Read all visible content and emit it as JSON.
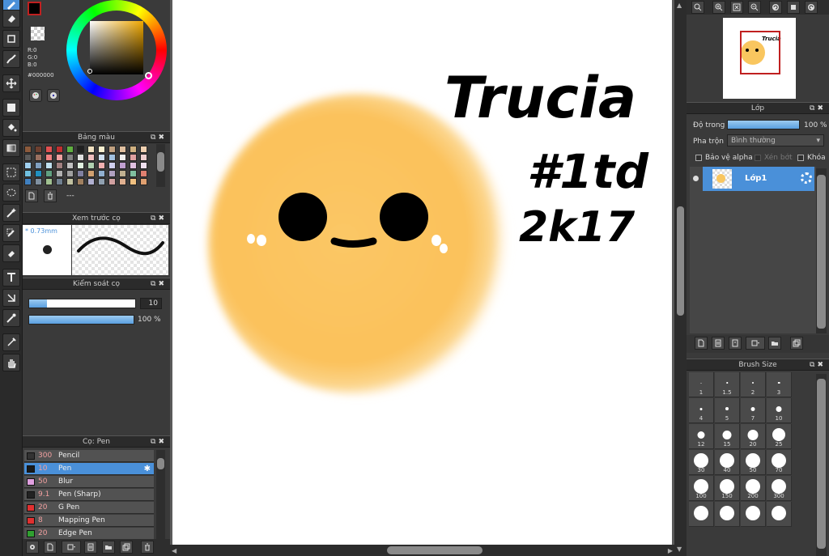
{
  "color": {
    "r_label": "R:0",
    "g_label": "G:0",
    "b_label": "B:0",
    "hex": "#000000",
    "foreground": "#000000",
    "background": "#7a3a2a"
  },
  "palette_panel": {
    "title": "Bảng màu",
    "footer_text": "---",
    "swatches": [
      "#8c5a3c",
      "#6e4030",
      "#e05050",
      "#c03030",
      "#60b040",
      "#202020",
      "#f0e0c0",
      "#f8f0d0",
      "#c0a080",
      "#e0c0a0",
      "#d0b080",
      "#f0d0b0",
      "#5a5a5a",
      "#9a7060",
      "#f08080",
      "#f0a0a0",
      "#808080",
      "#e0e0e0",
      "#f0c0c0",
      "#d0e0f0",
      "#a0c0e0",
      "#f0f0f0",
      "#e0a0a0",
      "#f0d0d0",
      "#a0d0f0",
      "#80a0c0",
      "#c0e0f0",
      "#a08080",
      "#c0c0c0",
      "#e0f0e0",
      "#b0d0b0",
      "#f0b0b0",
      "#d0d0f0",
      "#c0a0d0",
      "#e0c0e0",
      "#f0e0f0",
      "#70c0e0",
      "#2090c0",
      "#60a080",
      "#b0b0b0",
      "#a0a0a0",
      "#8080a0",
      "#d0a070",
      "#90b0d0",
      "#b0a0c0",
      "#c0b090",
      "#80c0a0",
      "#e08070",
      "#4080c0",
      "#8090a0",
      "#a0c090",
      "#708090",
      "#c0c0a0",
      "#a08060",
      "#b0b0d0",
      "#90a0b0",
      "#d0a0a0",
      "#e0b090",
      "#f0c080",
      "#e0a070"
    ]
  },
  "brush_preview_panel": {
    "title": "Xem trước cọ",
    "size_label": "* 0.73mm"
  },
  "brush_control_panel": {
    "title": "Kiểm soát cọ",
    "size_value": "10",
    "size_fraction": 0.17,
    "opacity_value": "100 %",
    "opacity_fraction": 1.0
  },
  "brush_list_panel": {
    "title": "Cọ: Pen",
    "items": [
      {
        "size": "300",
        "name": "Pencil",
        "color": "#333333",
        "selected": false
      },
      {
        "size": "10",
        "name": "Pen",
        "color": "#1a1a1a",
        "selected": true
      },
      {
        "size": "50",
        "name": "Blur",
        "color": "#e0a0e0",
        "selected": false
      },
      {
        "size": "9.1",
        "name": "Pen (Sharp)",
        "color": "#222222",
        "selected": false
      },
      {
        "size": "20",
        "name": "G Pen",
        "color": "#e03030",
        "selected": false
      },
      {
        "size": "8",
        "name": "Mapping Pen",
        "color": "#e03030",
        "selected": false
      },
      {
        "size": "20",
        "name": "Edge Pen",
        "color": "#30a030",
        "selected": false
      }
    ]
  },
  "canvas": {
    "text_line1": "Trucia",
    "text_line2": "#1td",
    "text_line3": "2k17"
  },
  "layer_panel": {
    "title": "Lớp",
    "opacity_label": "Độ trong",
    "opacity_value": "100 %",
    "opacity_fraction": 1.0,
    "blend_label": "Pha trộn",
    "blend_value": "Bình thường",
    "protect_alpha_label": "Bảo vệ alpha",
    "clipping_label": "Xén bớt",
    "lock_label": "Khóa",
    "layer_name": "Lớp1"
  },
  "brush_size_panel": {
    "title": "Brush Size",
    "sizes": [
      "1",
      "1.5",
      "2",
      "3",
      "4",
      "5",
      "7",
      "10",
      "12",
      "15",
      "20",
      "25",
      "30",
      "40",
      "50",
      "70",
      "100",
      "150",
      "200",
      "300",
      "",
      "",
      "",
      ""
    ]
  }
}
